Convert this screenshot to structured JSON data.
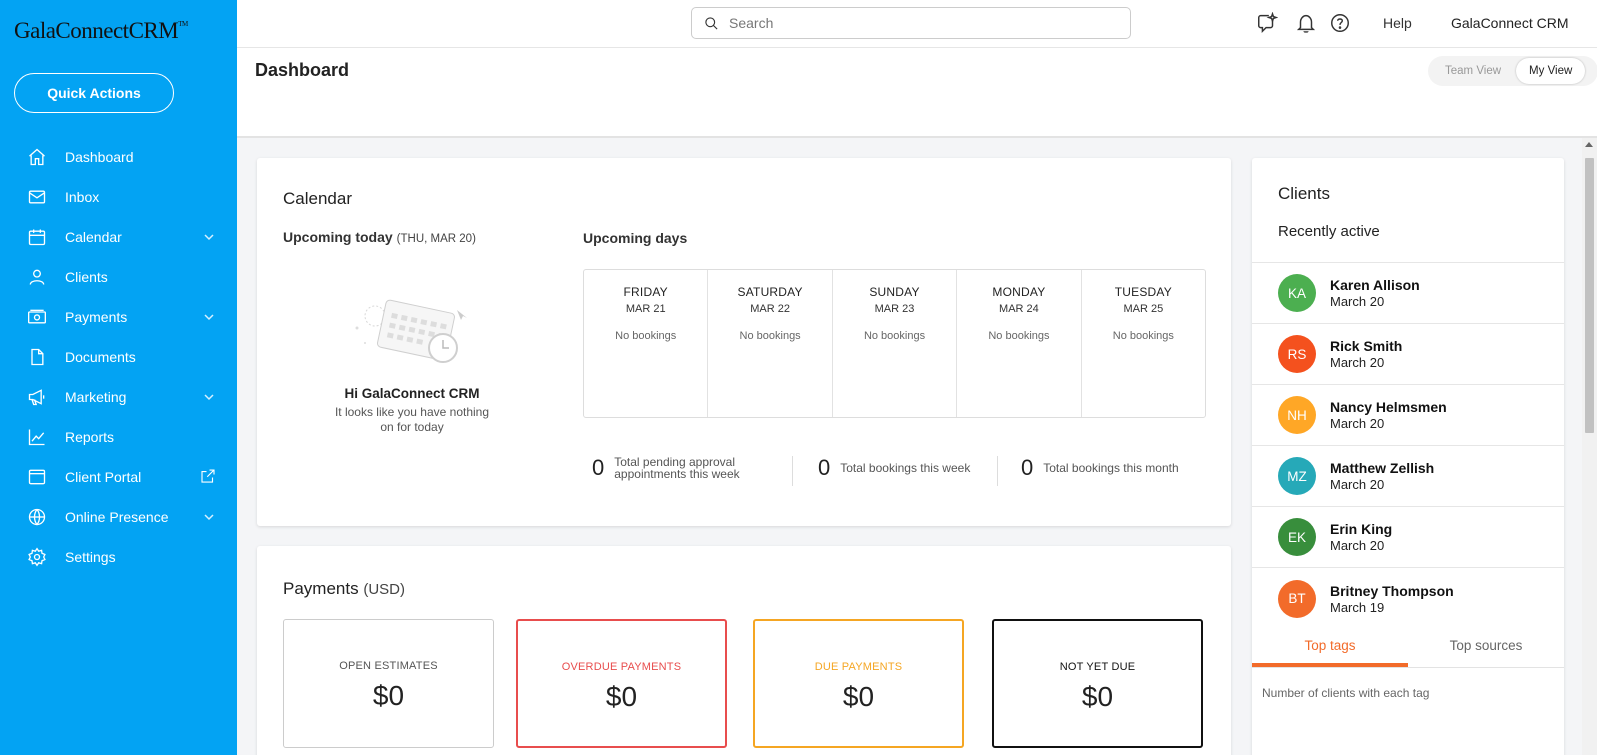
{
  "app": {
    "logo": "GalaConnectCRM",
    "logo_tm": "TM"
  },
  "sidebar": {
    "quick_actions": "Quick Actions",
    "items": [
      {
        "label": "Dashboard",
        "icon": "home-icon",
        "has_chevron": false
      },
      {
        "label": "Inbox",
        "icon": "envelope-icon",
        "has_chevron": false
      },
      {
        "label": "Calendar",
        "icon": "calendar-icon",
        "has_chevron": true
      },
      {
        "label": "Clients",
        "icon": "person-icon",
        "has_chevron": false
      },
      {
        "label": "Payments",
        "icon": "money-icon",
        "has_chevron": true
      },
      {
        "label": "Documents",
        "icon": "document-icon",
        "has_chevron": false
      },
      {
        "label": "Marketing",
        "icon": "megaphone-icon",
        "has_chevron": true
      },
      {
        "label": "Reports",
        "icon": "chart-line-icon",
        "has_chevron": false
      },
      {
        "label": "Client Portal",
        "icon": "browser-window-icon",
        "has_external": true
      },
      {
        "label": "Online Presence",
        "icon": "globe-icon",
        "has_chevron": true
      },
      {
        "label": "Settings",
        "icon": "gear-icon",
        "has_chevron": false
      }
    ]
  },
  "topbar": {
    "search_placeholder": "Search",
    "help": "Help",
    "account": "GalaConnect CRM"
  },
  "header": {
    "title": "Dashboard",
    "team_view": "Team View",
    "my_view": "My View"
  },
  "calendar": {
    "title": "Calendar",
    "upcoming_today": "Upcoming today",
    "today_date": "(THU, MAR 20)",
    "upcoming_days": "Upcoming days",
    "greeting": "Hi GalaConnect CRM",
    "empty_message": "It looks like you have nothing on for today",
    "days": [
      {
        "name": "FRIDAY",
        "date": "MAR 21",
        "status": "No bookings"
      },
      {
        "name": "SATURDAY",
        "date": "MAR 22",
        "status": "No bookings"
      },
      {
        "name": "SUNDAY",
        "date": "MAR 23",
        "status": "No bookings"
      },
      {
        "name": "MONDAY",
        "date": "MAR 24",
        "status": "No bookings"
      },
      {
        "name": "TUESDAY",
        "date": "MAR 25",
        "status": "No bookings"
      }
    ],
    "stats": [
      {
        "value": "0",
        "label_line1": "Total pending approval",
        "label_line2": "appointments this week"
      },
      {
        "value": "0",
        "label_line1": "Total bookings this week",
        "label_line2": ""
      },
      {
        "value": "0",
        "label_line1": "Total bookings this month",
        "label_line2": ""
      }
    ]
  },
  "payments": {
    "title": "Payments",
    "currency": "(USD)",
    "boxes": [
      {
        "label": "OPEN ESTIMATES",
        "value": "$0",
        "color": "#cccccc",
        "label_color": "#555555"
      },
      {
        "label": "OVERDUE PAYMENTS",
        "value": "$0",
        "color": "#e84d4d",
        "label_color": "#e84d4d"
      },
      {
        "label": "DUE PAYMENTS",
        "value": "$0",
        "color": "#f5a623",
        "label_color": "#f5a623"
      },
      {
        "label": "NOT YET DUE",
        "value": "$0",
        "color": "#111111",
        "label_color": "#111111"
      }
    ]
  },
  "clients": {
    "title": "Clients",
    "subtitle": "Recently active",
    "list": [
      {
        "initials": "KA",
        "name": "Karen Allison",
        "date": "March 20",
        "color": "#4caf50"
      },
      {
        "initials": "RS",
        "name": "Rick Smith",
        "date": "March 20",
        "color": "#f4511e"
      },
      {
        "initials": "NH",
        "name": "Nancy Helmsmen",
        "date": "March 20",
        "color": "#ffa726"
      },
      {
        "initials": "MZ",
        "name": "Matthew Zellish",
        "date": "March 20",
        "color": "#26a9b8"
      },
      {
        "initials": "EK",
        "name": "Erin King",
        "date": "March 20",
        "color": "#388e3c"
      },
      {
        "initials": "BT",
        "name": "Britney Thompson",
        "date": "March 19",
        "color": "#f26b2a"
      }
    ],
    "tabs": [
      "Top tags",
      "Top sources"
    ],
    "tag_note": "Number of clients with each tag"
  },
  "colors": {
    "sidebar": "#03a3f3",
    "accent": "#f26b2a"
  }
}
